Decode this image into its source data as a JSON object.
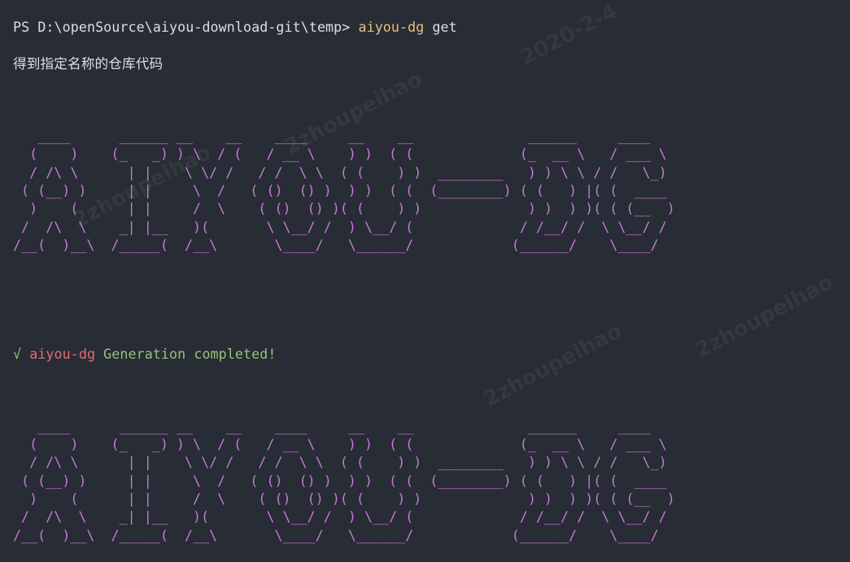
{
  "terminal": {
    "prompt_line": {
      "prompt": "PS D:\\openSource\\aiyou-download-git\\temp> ",
      "command": "aiyou-dg",
      "argument": " get"
    },
    "info_line": "得到指定名称的仓库代码",
    "banner_1": "   ____      ______ __    __    ____     __    __              ______     ____\n  (    )    (_   _) ) \\  / (   / __ \\    ) )  ( (             (_  __ \\   / ___ \\\n  / /\\ \\      | |    \\ \\/ /   / /  \\ \\  ( (    ) )  ________   ) ) \\ \\ / /   \\_)\n ( (__) )     | |     \\  /   ( ()  () )  ) )  ( (  (________) ( (   ) |( (  ____\n  )    (      | |     /  \\    ( ()  () )( (    ) )             ) )  ) )( ( (__  )\n /  /\\  \\    _| |__   )(       \\ \\__/ /  ) \\__/ (             / /__/ /  \\ \\__/ /\n/__(  )__\\  /_____(  /__\\       \\____/   \\______/            (______/    \\____/",
    "status": {
      "check": "√",
      "name": "aiyou-dg",
      "message": " Generation completed!"
    },
    "banner_2": "   ____      ______ __    __    ____     __    __              ______     ____\n  (    )    (_   _) ) \\  / (   / __ \\    ) )  ( (             (_  __ \\   / ___ \\\n  / /\\ \\      | |    \\ \\/ /   / /  \\ \\  ( (    ) )  ________   ) ) \\ \\ / /   \\_)\n ( (__) )     | |     \\  /   ( ()  () )  ) )  ( (  (________) ( (   ) |( (  ____\n  )    (      | |     /  \\    ( ()  () )( (    ) )             ) )  ) )( ( (__  )\n /  /\\  \\    _| |__   )(       \\ \\__/ /  ) \\__/ (             / /__/ /  \\ \\__/ /\n/__(  )__\\  /_____(  /__\\       \\____/   \\______/            (______/    \\____/"
  },
  "watermarks": [
    "2020-2-4",
    "2zhoupeihao",
    "2zhoupeihao",
    "2zhoupeihao",
    "2zhoupeihao"
  ],
  "colors": {
    "background": "#282c34",
    "foreground": "#dcdfe4",
    "command": "#e5c07b",
    "success": "#98c379",
    "name": "#e06c75",
    "banner": "#c678dd"
  }
}
